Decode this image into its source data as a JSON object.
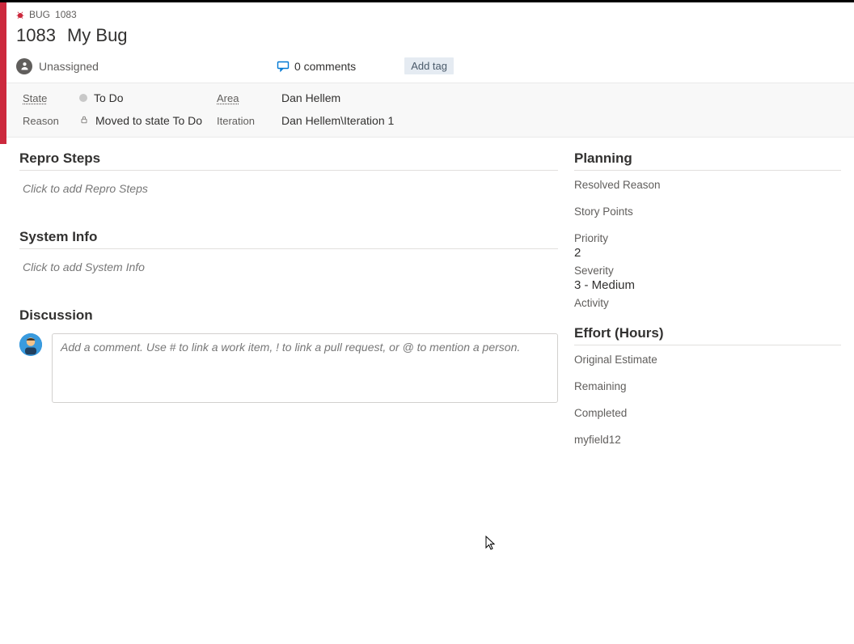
{
  "crumb": {
    "type": "BUG",
    "id": "1083"
  },
  "title": {
    "id": "1083",
    "text": "My Bug"
  },
  "assigned": "Unassigned",
  "comments_label": "0 comments",
  "add_tag_label": "Add tag",
  "fields": {
    "labels": {
      "state": "State",
      "reason": "Reason",
      "area": "Area",
      "iteration": "Iteration"
    },
    "state": "To Do",
    "reason": "Moved to state To Do",
    "area": "Dan Hellem",
    "iteration": "Dan Hellem\\Iteration 1"
  },
  "left": {
    "repro": {
      "title": "Repro Steps",
      "placeholder": "Click to add Repro Steps"
    },
    "sysinfo": {
      "title": "System Info",
      "placeholder": "Click to add System Info"
    },
    "discussion": {
      "title": "Discussion",
      "placeholder": "Add a comment. Use # to link a work item, ! to link a pull request, or @ to mention a person."
    }
  },
  "right": {
    "planning": {
      "title": "Planning",
      "resolved_reason": {
        "label": "Resolved Reason",
        "value": ""
      },
      "story_points": {
        "label": "Story Points",
        "value": ""
      },
      "priority": {
        "label": "Priority",
        "value": "2"
      },
      "severity": {
        "label": "Severity",
        "value": "3 - Medium"
      },
      "activity": {
        "label": "Activity",
        "value": ""
      }
    },
    "effort": {
      "title": "Effort (Hours)",
      "original_estimate": {
        "label": "Original Estimate",
        "value": ""
      },
      "remaining": {
        "label": "Remaining",
        "value": ""
      },
      "completed": {
        "label": "Completed",
        "value": ""
      },
      "myfield12": {
        "label": "myfield12",
        "value": ""
      }
    }
  }
}
